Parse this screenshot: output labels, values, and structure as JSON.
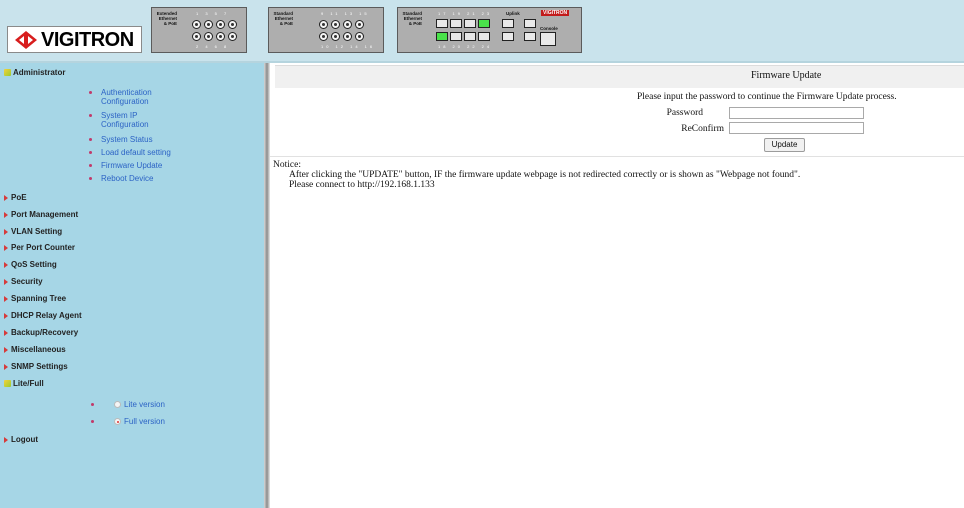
{
  "header": {
    "logo_text": "VIGITRON",
    "switch_panels": [
      {
        "label_lines": [
          "Extended",
          "Ethernet",
          "& PoE"
        ],
        "top_numbers": "1 3 5 7",
        "bottom_numbers": "2 4 6 8"
      },
      {
        "label_lines": [
          "Standard",
          "Ethernet",
          "& PoE"
        ],
        "top_numbers": "9 11 13 15",
        "bottom_numbers": "10 12 14 16"
      },
      {
        "label_lines": [
          "Standard",
          "Ethernet",
          "& PoE"
        ],
        "top_numbers": "17 19 21 23",
        "bottom_numbers": "18 20 22 24",
        "uplink_label": "Uplink",
        "console_label": "Console",
        "mini_logo": "VIGITRON"
      }
    ]
  },
  "sidebar": {
    "administrator": "Administrator",
    "admin_items": [
      "Authentication Configuration",
      "System IP Configuration",
      "System Status",
      "Load default setting",
      "Firmware Update",
      "Reboot Device"
    ],
    "menu": [
      "PoE",
      "Port Management",
      "VLAN Setting",
      "Per Port Counter",
      "QoS Setting",
      "Security",
      "Spanning Tree",
      "DHCP Relay Agent",
      "Backup/Recovery",
      "Miscellaneous",
      "SNMP Settings"
    ],
    "lite_full": "Lite/Full",
    "versions": {
      "lite": "Lite version",
      "full": "Full version",
      "selected": "Full version"
    },
    "logout": "Logout"
  },
  "main": {
    "title": "Firmware Update",
    "instruction": "Please input the password to continue the Firmware Update process.",
    "password_label": "Password",
    "password_value": "",
    "reconfirm_label": "ReConfirm",
    "reconfirm_value": "",
    "update_button": "Update",
    "notice_title": "Notice:",
    "notice_line1": "After clicking the \"UPDATE\" button, IF the firmware update webpage is not redirected correctly or is shown as \"Webpage not found\".",
    "notice_line2": "Please connect to http://192.168.1.133"
  }
}
